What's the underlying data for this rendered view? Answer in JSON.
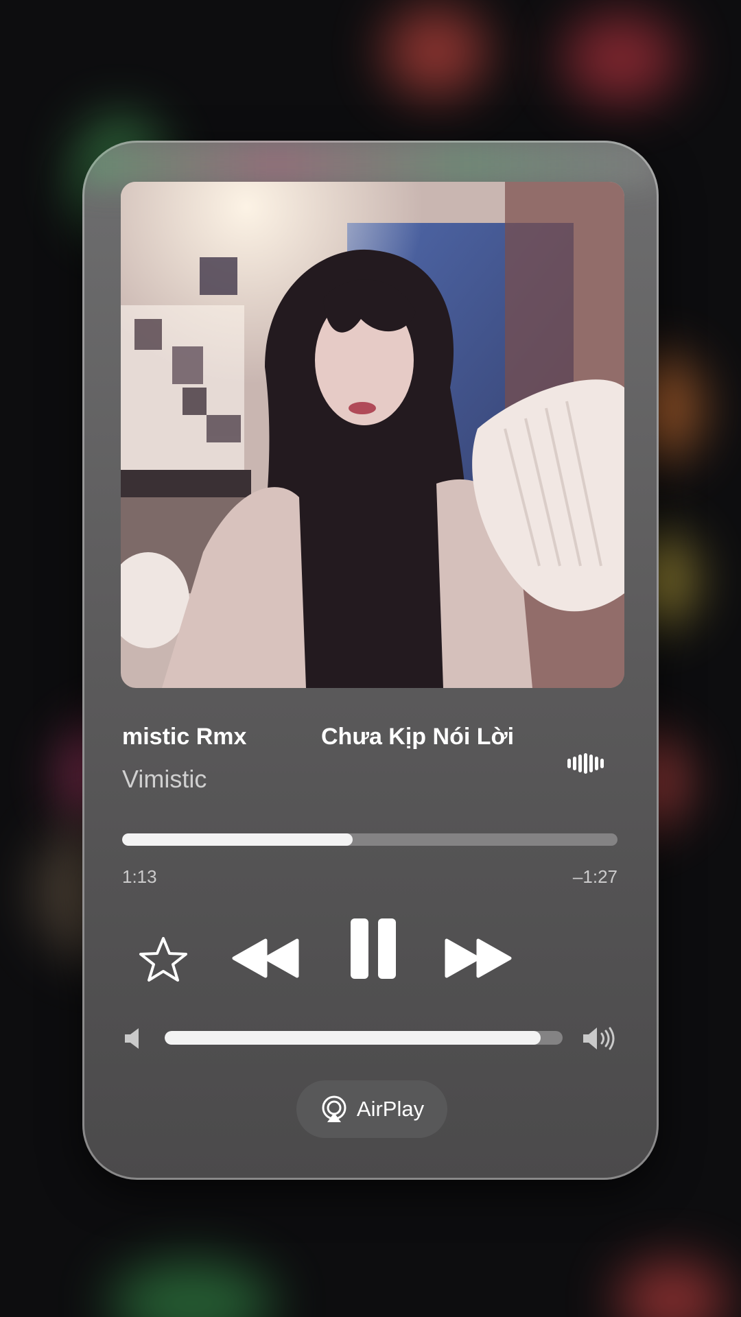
{
  "now_playing": {
    "title_tail": "mistic Rmx",
    "title": "Chưa Kịp Nói Lời",
    "artist": "Vimistic",
    "progress_fraction": 0.465,
    "elapsed": "1:13",
    "remaining": "–1:27",
    "volume_fraction": 0.945
  },
  "controls": {
    "favorite_icon": "star-icon",
    "previous_icon": "backward-icon",
    "playpause_icon": "pause-icon",
    "next_icon": "forward-icon",
    "volume_low_icon": "speaker-low-icon",
    "volume_high_icon": "speaker-high-icon"
  },
  "airplay": {
    "label": "AirPlay",
    "icon": "airplay-icon"
  },
  "colors": {
    "accent": "#ffffff",
    "card": "#5f5e5f"
  }
}
